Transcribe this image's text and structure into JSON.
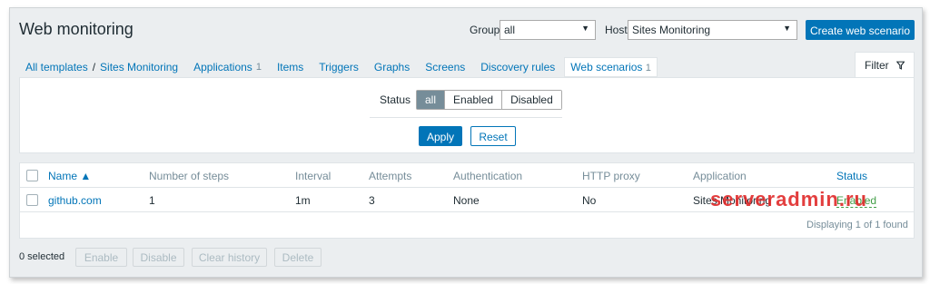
{
  "header": {
    "title": "Web monitoring",
    "group_label": "Group",
    "group_value": "all",
    "host_label": "Host",
    "host_value": "Sites Monitoring",
    "create_button": "Create web scenario"
  },
  "nav": {
    "all_templates": "All templates",
    "separator": "/",
    "sites_monitoring": "Sites Monitoring",
    "applications": "Applications",
    "applications_count": "1",
    "items": "Items",
    "triggers": "Triggers",
    "graphs": "Graphs",
    "screens": "Screens",
    "discovery_rules": "Discovery rules",
    "web_scenarios": "Web scenarios",
    "web_scenarios_count": "1"
  },
  "filter": {
    "tab_label": "Filter",
    "status_label": "Status",
    "status_options": [
      "all",
      "Enabled",
      "Disabled"
    ],
    "status_selected": "all",
    "apply": "Apply",
    "reset": "Reset"
  },
  "table": {
    "columns": [
      "Name ▲",
      "Number of steps",
      "Interval",
      "Attempts",
      "Authentication",
      "HTTP proxy",
      "Application",
      "Status"
    ],
    "rows": [
      {
        "name": "github.com",
        "steps": "1",
        "interval": "1m",
        "attempts": "3",
        "authentication": "None",
        "http_proxy": "No",
        "application": "Sites Monitoring",
        "status": "Enabled"
      }
    ],
    "footer": "Displaying 1 of 1 found"
  },
  "actions": {
    "selected": "0 selected",
    "enable": "Enable",
    "disable": "Disable",
    "clear_history": "Clear history",
    "delete": "Delete"
  },
  "watermark": "serveradmin.ru",
  "colors": {
    "accent": "#0275b8",
    "status_enabled": "#429e47",
    "background": "#ebeef0"
  }
}
